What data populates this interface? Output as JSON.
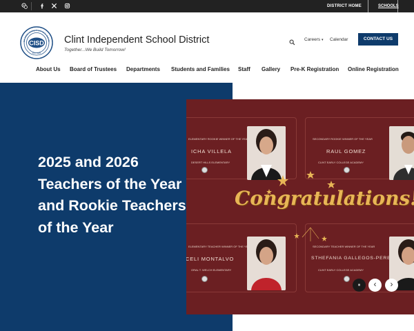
{
  "topbar": {
    "social_icons": [
      "translate-icon",
      "facebook-icon",
      "x-icon",
      "instagram-icon"
    ],
    "district_home": "DISTRICT HOME",
    "schools": "SCHOOLS"
  },
  "header": {
    "logo_text": "CISD",
    "logo_ring_text": "CLINT INDEPENDENT SCHOOL DISTRICT",
    "logo_est": "EST. 1909",
    "district_name": "Clint Independent School District",
    "tagline": "Together...We Build Tomorrow!",
    "careers": "Careers",
    "calendar": "Calendar",
    "contact": "CONTACT US"
  },
  "nav": {
    "items": [
      "About Us",
      "Board of Trustees",
      "Departments",
      "Students and Families",
      "Staff",
      "Gallery",
      "Pre-K Registration",
      "Online Registration"
    ]
  },
  "hero": {
    "title": "2025 and 2026 Teachers of the Year and Rookie Teachers of the Year",
    "slide": {
      "congrats": "Congratulations!",
      "cards": [
        {
          "label": "ELEMENTARY ROOKIE WINNER OF THE YEAR",
          "name": "ICHA VILLELA",
          "school": "DESERT HILLS ELEMENTARY"
        },
        {
          "label": "SECONDARY ROOKIE WINNER OF THE YEAR",
          "name": "RAUL GOMEZ",
          "school": "CLINT EARLY COLLEGE ACADEMY"
        },
        {
          "label": "ELEMENTARY TEACHER WINNER OF THE YEAR",
          "name": "CELI MONTALVO",
          "school": "ORAL T. WELCH ELEMENTARY"
        },
        {
          "label": "SECONDARY TEACHER WINNER OF THE YEAR",
          "name": "STHEFANIA GALLEGOS-PEREZ",
          "school": "CLINT EARLY COLLEGE ACADEMY"
        }
      ]
    },
    "controls": {
      "pause": "⏸",
      "prev": "‹",
      "next": "›"
    }
  },
  "colors": {
    "brand": "#0e3b6b",
    "topbar": "#222222",
    "slide_bg": "#6b1f22",
    "gold": "#e8b656"
  }
}
